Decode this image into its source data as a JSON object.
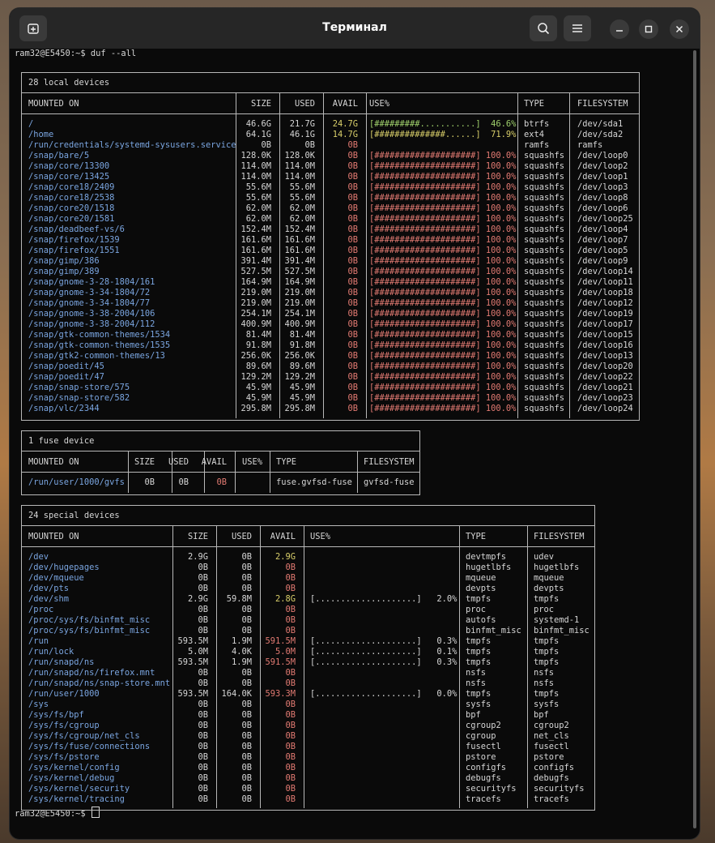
{
  "window": {
    "title": "Терминал"
  },
  "command_line": {
    "prompt": "ram32@E5450:~$ ",
    "command": "duf --all"
  },
  "end_prompt": "ram32@E5450:~$ ",
  "local": {
    "caption": "28 local devices",
    "headers": [
      "MOUNTED ON",
      "SIZE",
      "USED",
      "AVAIL",
      "USE%",
      "TYPE",
      "FILESYSTEM"
    ],
    "rows": [
      [
        "/",
        "46.6G",
        "21.7G",
        "24.7G",
        "[#########...........]  46.6%",
        "btrfs",
        "/dev/sda1"
      ],
      [
        "/home",
        "64.1G",
        "46.1G",
        "14.7G",
        "[##############......]  71.9%",
        "ext4",
        "/dev/sda2"
      ],
      [
        "/run/credentials/systemd-sysusers.service",
        "0B",
        "0B",
        "0B",
        "",
        "ramfs",
        "ramfs"
      ],
      [
        "/snap/bare/5",
        "128.0K",
        "128.0K",
        "0B",
        "[####################] 100.0%",
        "squashfs",
        "/dev/loop0"
      ],
      [
        "/snap/core/13300",
        "114.0M",
        "114.0M",
        "0B",
        "[####################] 100.0%",
        "squashfs",
        "/dev/loop2"
      ],
      [
        "/snap/core/13425",
        "114.0M",
        "114.0M",
        "0B",
        "[####################] 100.0%",
        "squashfs",
        "/dev/loop1"
      ],
      [
        "/snap/core18/2409",
        "55.6M",
        "55.6M",
        "0B",
        "[####################] 100.0%",
        "squashfs",
        "/dev/loop3"
      ],
      [
        "/snap/core18/2538",
        "55.6M",
        "55.6M",
        "0B",
        "[####################] 100.0%",
        "squashfs",
        "/dev/loop8"
      ],
      [
        "/snap/core20/1518",
        "62.0M",
        "62.0M",
        "0B",
        "[####################] 100.0%",
        "squashfs",
        "/dev/loop6"
      ],
      [
        "/snap/core20/1581",
        "62.0M",
        "62.0M",
        "0B",
        "[####################] 100.0%",
        "squashfs",
        "/dev/loop25"
      ],
      [
        "/snap/deadbeef-vs/6",
        "152.4M",
        "152.4M",
        "0B",
        "[####################] 100.0%",
        "squashfs",
        "/dev/loop4"
      ],
      [
        "/snap/firefox/1539",
        "161.6M",
        "161.6M",
        "0B",
        "[####################] 100.0%",
        "squashfs",
        "/dev/loop7"
      ],
      [
        "/snap/firefox/1551",
        "161.6M",
        "161.6M",
        "0B",
        "[####################] 100.0%",
        "squashfs",
        "/dev/loop5"
      ],
      [
        "/snap/gimp/386",
        "391.4M",
        "391.4M",
        "0B",
        "[####################] 100.0%",
        "squashfs",
        "/dev/loop9"
      ],
      [
        "/snap/gimp/389",
        "527.5M",
        "527.5M",
        "0B",
        "[####################] 100.0%",
        "squashfs",
        "/dev/loop14"
      ],
      [
        "/snap/gnome-3-28-1804/161",
        "164.9M",
        "164.9M",
        "0B",
        "[####################] 100.0%",
        "squashfs",
        "/dev/loop11"
      ],
      [
        "/snap/gnome-3-34-1804/72",
        "219.0M",
        "219.0M",
        "0B",
        "[####################] 100.0%",
        "squashfs",
        "/dev/loop18"
      ],
      [
        "/snap/gnome-3-34-1804/77",
        "219.0M",
        "219.0M",
        "0B",
        "[####################] 100.0%",
        "squashfs",
        "/dev/loop12"
      ],
      [
        "/snap/gnome-3-38-2004/106",
        "254.1M",
        "254.1M",
        "0B",
        "[####################] 100.0%",
        "squashfs",
        "/dev/loop19"
      ],
      [
        "/snap/gnome-3-38-2004/112",
        "400.9M",
        "400.9M",
        "0B",
        "[####################] 100.0%",
        "squashfs",
        "/dev/loop17"
      ],
      [
        "/snap/gtk-common-themes/1534",
        "81.4M",
        "81.4M",
        "0B",
        "[####################] 100.0%",
        "squashfs",
        "/dev/loop15"
      ],
      [
        "/snap/gtk-common-themes/1535",
        "91.8M",
        "91.8M",
        "0B",
        "[####################] 100.0%",
        "squashfs",
        "/dev/loop16"
      ],
      [
        "/snap/gtk2-common-themes/13",
        "256.0K",
        "256.0K",
        "0B",
        "[####################] 100.0%",
        "squashfs",
        "/dev/loop13"
      ],
      [
        "/snap/poedit/45",
        "89.6M",
        "89.6M",
        "0B",
        "[####################] 100.0%",
        "squashfs",
        "/dev/loop20"
      ],
      [
        "/snap/poedit/47",
        "129.2M",
        "129.2M",
        "0B",
        "[####################] 100.0%",
        "squashfs",
        "/dev/loop22"
      ],
      [
        "/snap/snap-store/575",
        "45.9M",
        "45.9M",
        "0B",
        "[####################] 100.0%",
        "squashfs",
        "/dev/loop21"
      ],
      [
        "/snap/snap-store/582",
        "45.9M",
        "45.9M",
        "0B",
        "[####################] 100.0%",
        "squashfs",
        "/dev/loop23"
      ],
      [
        "/snap/vlc/2344",
        "295.8M",
        "295.8M",
        "0B",
        "[####################] 100.0%",
        "squashfs",
        "/dev/loop24"
      ]
    ]
  },
  "fuse": {
    "caption": "1 fuse device",
    "headers": [
      "MOUNTED ON",
      "SIZE",
      "USED",
      "AVAIL",
      "USE%",
      "TYPE",
      "FILESYSTEM"
    ],
    "rows": [
      [
        "/run/user/1000/gvfs",
        "0B",
        "0B",
        "0B",
        "",
        "fuse.gvfsd-fuse",
        "gvfsd-fuse"
      ]
    ]
  },
  "special": {
    "caption": "24 special devices",
    "headers": [
      "MOUNTED ON",
      "SIZE",
      "USED",
      "AVAIL",
      "USE%",
      "TYPE",
      "FILESYSTEM"
    ],
    "rows": [
      [
        "/dev",
        "2.9G",
        "0B",
        "2.9G",
        "",
        "devtmpfs",
        "udev"
      ],
      [
        "/dev/hugepages",
        "0B",
        "0B",
        "0B",
        "",
        "hugetlbfs",
        "hugetlbfs"
      ],
      [
        "/dev/mqueue",
        "0B",
        "0B",
        "0B",
        "",
        "mqueue",
        "mqueue"
      ],
      [
        "/dev/pts",
        "0B",
        "0B",
        "0B",
        "",
        "devpts",
        "devpts"
      ],
      [
        "/dev/shm",
        "2.9G",
        "59.8M",
        "2.8G",
        "[....................]   2.0%",
        "tmpfs",
        "tmpfs"
      ],
      [
        "/proc",
        "0B",
        "0B",
        "0B",
        "",
        "proc",
        "proc"
      ],
      [
        "/proc/sys/fs/binfmt_misc",
        "0B",
        "0B",
        "0B",
        "",
        "autofs",
        "systemd-1"
      ],
      [
        "/proc/sys/fs/binfmt_misc",
        "0B",
        "0B",
        "0B",
        "",
        "binfmt_misc",
        "binfmt_misc"
      ],
      [
        "/run",
        "593.5M",
        "1.9M",
        "591.5M",
        "[....................]   0.3%",
        "tmpfs",
        "tmpfs"
      ],
      [
        "/run/lock",
        "5.0M",
        "4.0K",
        "5.0M",
        "[....................]   0.1%",
        "tmpfs",
        "tmpfs"
      ],
      [
        "/run/snapd/ns",
        "593.5M",
        "1.9M",
        "591.5M",
        "[....................]   0.3%",
        "tmpfs",
        "tmpfs"
      ],
      [
        "/run/snapd/ns/firefox.mnt",
        "0B",
        "0B",
        "0B",
        "",
        "nsfs",
        "nsfs"
      ],
      [
        "/run/snapd/ns/snap-store.mnt",
        "0B",
        "0B",
        "0B",
        "",
        "nsfs",
        "nsfs"
      ],
      [
        "/run/user/1000",
        "593.5M",
        "164.0K",
        "593.3M",
        "[....................]   0.0%",
        "tmpfs",
        "tmpfs"
      ],
      [
        "/sys",
        "0B",
        "0B",
        "0B",
        "",
        "sysfs",
        "sysfs"
      ],
      [
        "/sys/fs/bpf",
        "0B",
        "0B",
        "0B",
        "",
        "bpf",
        "bpf"
      ],
      [
        "/sys/fs/cgroup",
        "0B",
        "0B",
        "0B",
        "",
        "cgroup2",
        "cgroup2"
      ],
      [
        "/sys/fs/cgroup/net_cls",
        "0B",
        "0B",
        "0B",
        "",
        "cgroup",
        "net_cls"
      ],
      [
        "/sys/fs/fuse/connections",
        "0B",
        "0B",
        "0B",
        "",
        "fusectl",
        "fusectl"
      ],
      [
        "/sys/fs/pstore",
        "0B",
        "0B",
        "0B",
        "",
        "pstore",
        "pstore"
      ],
      [
        "/sys/kernel/config",
        "0B",
        "0B",
        "0B",
        "",
        "configfs",
        "configfs"
      ],
      [
        "/sys/kernel/debug",
        "0B",
        "0B",
        "0B",
        "",
        "debugfs",
        "debugfs"
      ],
      [
        "/sys/kernel/security",
        "0B",
        "0B",
        "0B",
        "",
        "securityfs",
        "securityfs"
      ],
      [
        "/sys/kernel/tracing",
        "0B",
        "0B",
        "0B",
        "",
        "tracefs",
        "tracefs"
      ]
    ]
  },
  "colors": {
    "mount": "#7aa5e0",
    "avail_ok": "#d9cf6a",
    "avail_bad": "#e27a72",
    "bar_full": "#e27a72",
    "bar_mid": "#9fd06b",
    "bar_warn": "#d9cf6a",
    "text": "#d6d6d6"
  },
  "icons": {
    "new_tab": "new-tab-icon",
    "search": "search-icon",
    "menu": "hamburger-menu-icon",
    "minimize": "minimize-icon",
    "maximize": "maximize-icon",
    "close": "close-icon"
  }
}
